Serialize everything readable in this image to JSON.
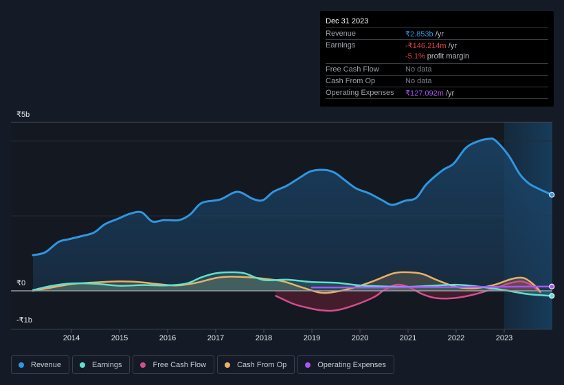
{
  "tooltip": {
    "date": "Dec 31 2023",
    "rows": [
      {
        "label": "Revenue",
        "value": "₹2.853b",
        "unit": " /yr",
        "color": "#2f96e0"
      },
      {
        "label": "Earnings",
        "value": "-₹146.214m",
        "unit": " /yr",
        "color": "#e5403f"
      },
      {
        "label": "",
        "value": "-5.1%",
        "unit": " profit margin",
        "color": "#e5403f"
      },
      {
        "label": "Free Cash Flow",
        "value": "No data",
        "unit": "",
        "color": "#7c8089"
      },
      {
        "label": "Cash From Op",
        "value": "No data",
        "unit": "",
        "color": "#7c8089"
      },
      {
        "label": "Operating Expenses",
        "value": "₹127.092m",
        "unit": " /yr",
        "color": "#a855f7"
      }
    ]
  },
  "chart_data": {
    "type": "area",
    "title": "",
    "xlabel": "",
    "ylabel": "",
    "y_tick_labels": [
      "₹5b",
      "₹0",
      "-₹1b"
    ],
    "y_ticks": [
      5,
      0,
      -1
    ],
    "ylim": [
      -1,
      5
    ],
    "xlim": [
      2013.2,
      2024.0
    ],
    "x_tick_labels": [
      "2014",
      "2015",
      "2016",
      "2017",
      "2018",
      "2019",
      "2020",
      "2021",
      "2022",
      "2023"
    ],
    "x_ticks": [
      2014,
      2015,
      2016,
      2017,
      2018,
      2019,
      2020,
      2021,
      2022,
      2023
    ],
    "forecast_shade_from": 2023.0,
    "legend_position": "bottom-left",
    "units": "₹ billions",
    "series": [
      {
        "name": "Revenue",
        "color": "#2f96e0",
        "fill": true,
        "x": [
          2013.2,
          2013.45,
          2013.73,
          2013.94,
          2014.23,
          2014.47,
          2014.7,
          2014.97,
          2015.22,
          2015.46,
          2015.68,
          2015.93,
          2016.24,
          2016.47,
          2016.71,
          2017.09,
          2017.45,
          2017.77,
          2017.98,
          2018.2,
          2018.48,
          2018.76,
          2018.98,
          2019.26,
          2019.47,
          2019.68,
          2019.92,
          2020.18,
          2020.46,
          2020.67,
          2020.93,
          2021.17,
          2021.38,
          2021.71,
          2021.95,
          2022.2,
          2022.44,
          2022.67,
          2022.81,
          2023.08,
          2023.32,
          2023.5,
          2023.67,
          2023.99
        ],
        "values": [
          1.06,
          1.14,
          1.45,
          1.53,
          1.63,
          1.73,
          1.98,
          2.14,
          2.29,
          2.33,
          2.06,
          2.1,
          2.1,
          2.27,
          2.61,
          2.71,
          2.94,
          2.73,
          2.69,
          2.94,
          3.12,
          3.37,
          3.55,
          3.59,
          3.51,
          3.29,
          3.04,
          2.9,
          2.69,
          2.55,
          2.67,
          2.76,
          3.16,
          3.57,
          3.78,
          4.24,
          4.43,
          4.51,
          4.47,
          4.04,
          3.47,
          3.2,
          3.06,
          2.85
        ]
      },
      {
        "name": "Earnings",
        "color": "#5fe0cf",
        "fill": true,
        "x": [
          2013.2,
          2013.6,
          2014.0,
          2014.5,
          2015.0,
          2015.5,
          2016.0,
          2016.4,
          2016.7,
          2017.0,
          2017.3,
          2017.6,
          2018.0,
          2018.5,
          2019.0,
          2019.5,
          2020.0,
          2020.5,
          2021.0,
          2021.5,
          2022.0,
          2022.5,
          2023.0,
          2023.5,
          2023.99
        ],
        "values": [
          0.02,
          0.15,
          0.22,
          0.21,
          0.15,
          0.17,
          0.16,
          0.22,
          0.4,
          0.52,
          0.55,
          0.52,
          0.32,
          0.33,
          0.26,
          0.24,
          0.16,
          0.13,
          0.12,
          0.15,
          0.18,
          0.12,
          0.02,
          -0.1,
          -0.15
        ]
      },
      {
        "name": "Free Cash Flow",
        "color": "#d24e8f",
        "fill": true,
        "x": [
          2018.25,
          2018.6,
          2018.9,
          2019.2,
          2019.5,
          2019.9,
          2020.3,
          2020.5,
          2020.75,
          2021.0,
          2021.3,
          2021.6,
          2022.0,
          2022.4,
          2022.8,
          2023.1,
          2023.35,
          2023.55,
          2023.75
        ],
        "values": [
          -0.15,
          -0.38,
          -0.5,
          -0.58,
          -0.58,
          -0.42,
          -0.18,
          0.02,
          0.18,
          0.12,
          -0.1,
          -0.22,
          -0.21,
          -0.1,
          0.07,
          0.22,
          0.28,
          0.18,
          -0.05
        ]
      },
      {
        "name": "Cash From Op",
        "color": "#e9b265",
        "fill": true,
        "x": [
          2013.2,
          2013.6,
          2014.0,
          2014.5,
          2015.0,
          2015.4,
          2015.8,
          2016.2,
          2016.6,
          2017.0,
          2017.3,
          2017.7,
          2018.0,
          2018.4,
          2018.8,
          2019.2,
          2019.6,
          2020.0,
          2020.3,
          2020.7,
          2021.0,
          2021.3,
          2021.6,
          2022.0,
          2022.4,
          2022.8,
          2023.15,
          2023.4,
          2023.6,
          2023.75
        ],
        "values": [
          0.0,
          0.1,
          0.2,
          0.25,
          0.28,
          0.26,
          0.2,
          0.16,
          0.24,
          0.38,
          0.42,
          0.4,
          0.36,
          0.28,
          0.1,
          -0.06,
          0.0,
          0.15,
          0.3,
          0.52,
          0.55,
          0.5,
          0.32,
          0.12,
          0.08,
          0.18,
          0.35,
          0.38,
          0.2,
          -0.02
        ]
      },
      {
        "name": "Operating Expenses",
        "color": "#a855f7",
        "fill": false,
        "x": [
          2019.0,
          2019.5,
          2020.0,
          2020.5,
          2021.0,
          2021.5,
          2022.0,
          2022.5,
          2023.0,
          2023.5,
          2023.99
        ],
        "values": [
          0.1,
          0.1,
          0.1,
          0.1,
          0.11,
          0.11,
          0.11,
          0.12,
          0.12,
          0.125,
          0.127
        ]
      }
    ]
  },
  "legend": {
    "items": [
      {
        "label": "Revenue",
        "color": "#2f96e0"
      },
      {
        "label": "Earnings",
        "color": "#5fe0cf"
      },
      {
        "label": "Free Cash Flow",
        "color": "#d24e8f"
      },
      {
        "label": "Cash From Op",
        "color": "#e9b265"
      },
      {
        "label": "Operating Expenses",
        "color": "#a855f7"
      }
    ]
  }
}
